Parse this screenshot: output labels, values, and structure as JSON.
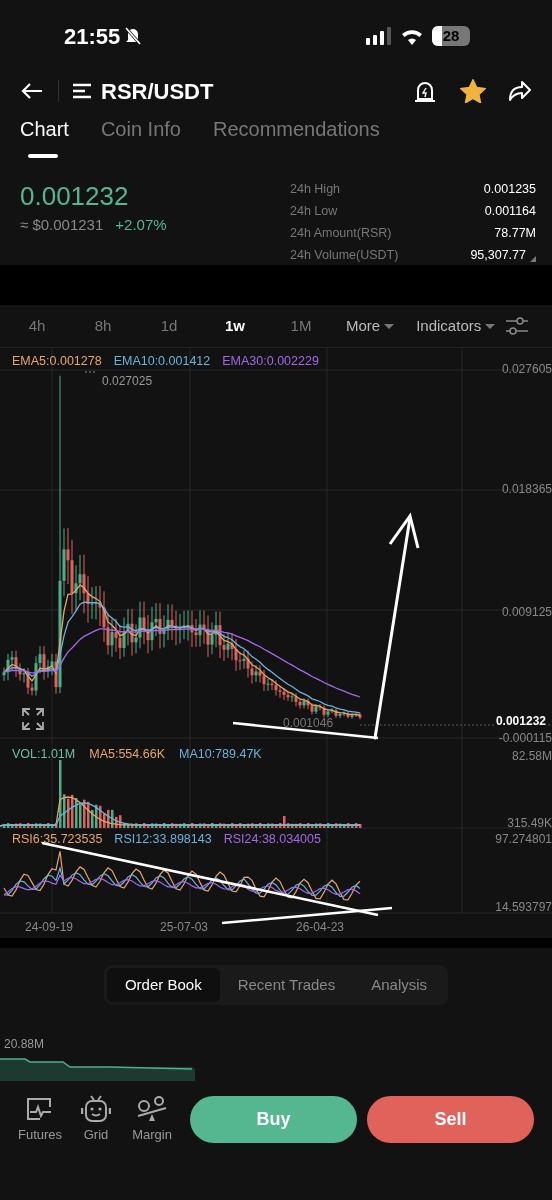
{
  "status_bar": {
    "time": "21:55",
    "battery": "28"
  },
  "header": {
    "title": "RSR/USDT",
    "favorite": true
  },
  "tabs": [
    {
      "label": "Chart",
      "selected": true
    },
    {
      "label": "Coin Info",
      "selected": false
    },
    {
      "label": "Recommendations",
      "selected": false
    }
  ],
  "price": {
    "last": "0.001232",
    "usd": "≈ $0.001231",
    "change": "+2.07%"
  },
  "stats": [
    {
      "label": "24h High",
      "value": "0.001235"
    },
    {
      "label": "24h Low",
      "value": "0.001164"
    },
    {
      "label": "24h Amount(RSR)",
      "value": "78.77M"
    },
    {
      "label": "24h Volume(USDT)",
      "value": "95,307.77"
    }
  ],
  "timeframes": [
    {
      "label": "4h",
      "selected": false
    },
    {
      "label": "8h",
      "selected": false
    },
    {
      "label": "1d",
      "selected": false
    },
    {
      "label": "1w",
      "selected": true
    },
    {
      "label": "1M",
      "selected": false
    }
  ],
  "menus": [
    "More",
    "Indicators"
  ],
  "main_chart": {
    "legend": [
      {
        "label": "EMA5:0.001278",
        "color": "#e8a56a"
      },
      {
        "label": "EMA10:0.001412",
        "color": "#6cb2de"
      },
      {
        "label": "EMA30:0.002229",
        "color": "#a467e6"
      }
    ],
    "axis": [
      "0.027605",
      "0.018365",
      "0.009125",
      "-0.000115"
    ],
    "high_marker": "0.027025",
    "low_marker": "0.001046",
    "last_price": "0.001232"
  },
  "volume": {
    "legend": [
      {
        "label": "VOL:1.01M",
        "color": "#6cbfa6"
      },
      {
        "label": "MA5:554.66K",
        "color": "#e8a56a"
      },
      {
        "label": "MA10:789.47K",
        "color": "#6cb2de"
      }
    ],
    "axis": [
      "82.58M",
      "315.49K"
    ]
  },
  "rsi": {
    "legend": [
      {
        "label": "RSI6:35.723535",
        "color": "#e8a56a"
      },
      {
        "label": "RSI12:33.898143",
        "color": "#6cb2de"
      },
      {
        "label": "RSI24:38.034005",
        "color": "#a467e6"
      }
    ],
    "axis": [
      "97.274801",
      "14.593797"
    ]
  },
  "x_axis": [
    "24-09-19",
    "25-07-03",
    "26-04-23"
  ],
  "bottom_tabs": [
    {
      "label": "Order Book",
      "selected": true
    },
    {
      "label": "Recent Trades",
      "selected": false
    },
    {
      "label": "Analysis",
      "selected": false
    }
  ],
  "depth": {
    "label": "20.88M"
  },
  "shortcuts": [
    {
      "label": "Futures",
      "kind": "futures"
    },
    {
      "label": "Grid",
      "kind": "grid"
    },
    {
      "label": "Margin",
      "kind": "margin"
    }
  ],
  "actions": [
    {
      "label": "Buy",
      "kind": "buy"
    },
    {
      "label": "Sell",
      "kind": "sell"
    }
  ]
}
